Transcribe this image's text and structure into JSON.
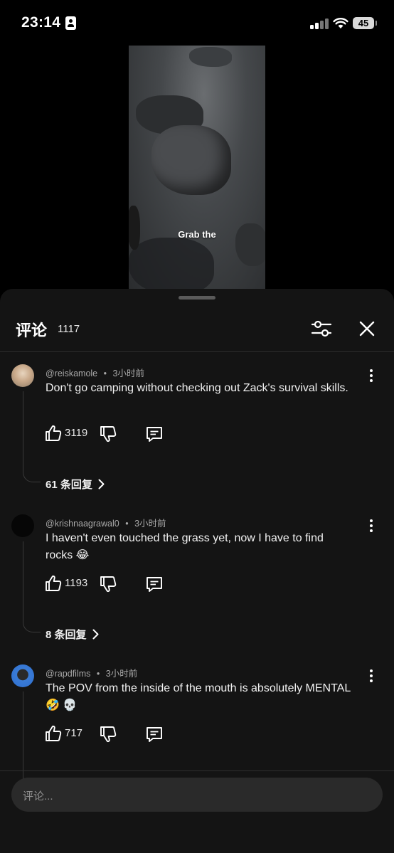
{
  "status": {
    "time": "23:14",
    "battery": "45"
  },
  "video": {
    "caption": "Grab the"
  },
  "sheet": {
    "title": "评论",
    "count": "1117"
  },
  "comments": [
    {
      "author": "@reiskamole",
      "time": "3小时前",
      "text": "Don't go camping without checking out Zack's survival skills.",
      "likes": "3119",
      "replies": "61 条回复"
    },
    {
      "author": "@krishnaagrawal0",
      "time": "3小时前",
      "text": "I haven't even touched the grass yet, now I have to find rocks 😂",
      "likes": "1193",
      "replies": "8 条回复"
    },
    {
      "author": "@rapdfilms",
      "time": "3小时前",
      "text": "The POV from the inside of the mouth is absolutely MENTAL 🤣 💀",
      "likes": "717"
    }
  ],
  "input": {
    "placeholder": "评论..."
  },
  "separator": "•"
}
